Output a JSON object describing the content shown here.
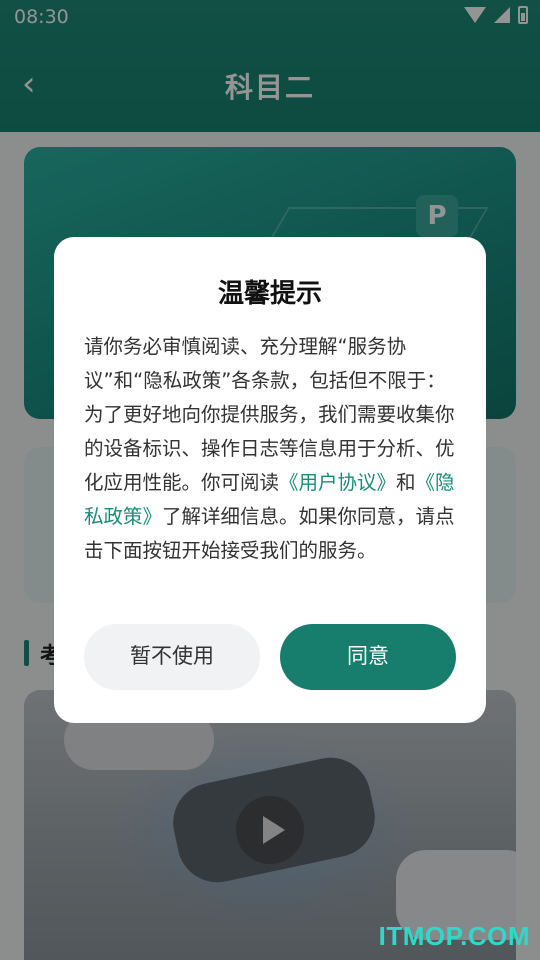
{
  "status_bar": {
    "time": "08:30"
  },
  "header": {
    "title": "科目二",
    "back_icon": "chevron-left-icon"
  },
  "banner": {
    "parking_sign": "P"
  },
  "section": {
    "title": "考"
  },
  "dialog": {
    "title": "温馨提示",
    "body_part1": "请你务必审慎阅读、充分理解“服务协议”和“隐私政策”各条款，包括但不限于：为了更好地向你提供服务，我们需要收集你的设备标识、操作日志等信息用于分析、优化应用性能。你可阅读",
    "link_user_agreement": "《用户协议》",
    "body_and": "和",
    "link_privacy_policy": "《隐私政策》",
    "body_part2": "了解详细信息。如果你同意，请点击下面按钮开始接受我们的服务。",
    "decline_label": "暂不使用",
    "agree_label": "同意"
  },
  "watermark": "ITMOP.COM",
  "colors": {
    "primary": "#1b8b79",
    "link": "#1b8b79",
    "decline_bg": "#f1f2f4"
  }
}
